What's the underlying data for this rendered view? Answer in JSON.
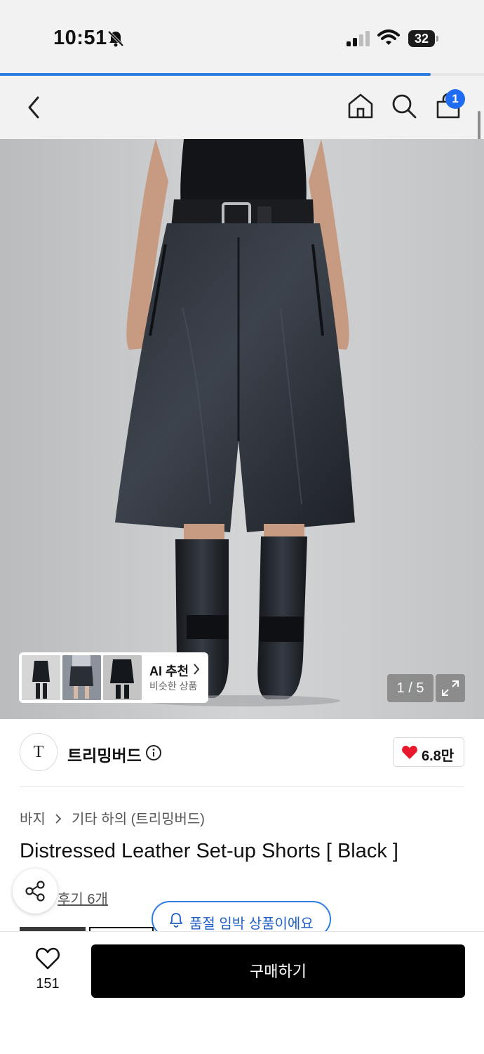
{
  "status_bar": {
    "time": "10:51",
    "battery": "32"
  },
  "page_load_progress": 0.89,
  "nav": {
    "cart_count": "1"
  },
  "gallery": {
    "ai_title": "AI 추천",
    "ai_subtitle": "비슷한 상품",
    "pager": "1 / 5"
  },
  "brand": {
    "logo_text": "T",
    "name": "트리밍버드",
    "likes": "6.8만"
  },
  "breadcrumb": {
    "category": "바지",
    "subcategory": "기타 하의 (트리밍버드)"
  },
  "product": {
    "title": "Distressed Leather Set-up Shorts [ Black ]"
  },
  "reviews": {
    "link_text": "후기 6개"
  },
  "toast": {
    "text": "품절 임박 상품이에요"
  },
  "bottom": {
    "wish_count": "151",
    "buy_label": "구매하기"
  },
  "colors": {
    "accent": "#2f7de1",
    "heart": "#e8192c",
    "buy_bg": "#000000"
  }
}
